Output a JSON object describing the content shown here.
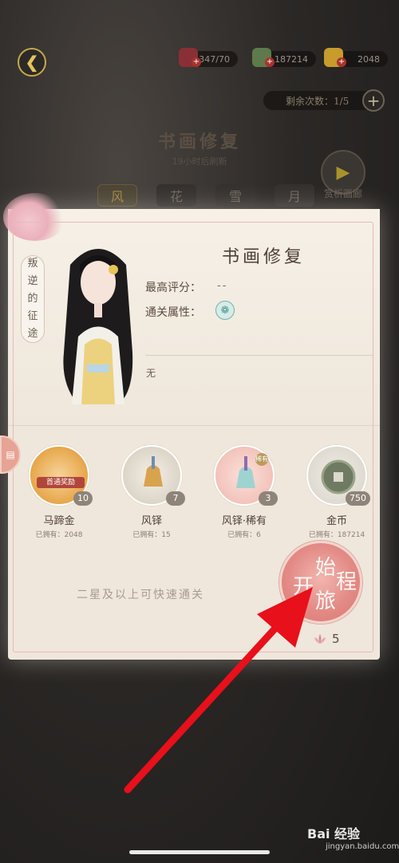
{
  "hud": {
    "stamina_value": "347/70",
    "silver_value": "187214",
    "gold_value": "2048",
    "remaining_label": "剩余次数：1/5"
  },
  "mode": {
    "title": "书画修复",
    "subtitle": "19小时后刷新",
    "gallery_label": "赏析画廊"
  },
  "seasons": [
    "风",
    "花",
    "雪",
    "月"
  ],
  "stage": {
    "chapter_tag": [
      "叛",
      "逆",
      "的",
      "征",
      "途"
    ],
    "title": "书画修复",
    "best_score_label": "最高评分：",
    "best_score_value": "--",
    "attribute_label": "通关属性：",
    "attribute_icon": "wind-attribute-icon",
    "description": "无"
  },
  "rewards": [
    {
      "name": "马蹄金",
      "owned": "已拥有：2048",
      "count": "10",
      "badge": "首通奖励",
      "icon": "horseshoe-gold-icon",
      "color": "#e7a64a"
    },
    {
      "name": "风铎",
      "owned": "已拥有：15",
      "count": "7",
      "icon": "wind-bell-icon",
      "color": "#d9a34e"
    },
    {
      "name": "风铎·稀有",
      "owned": "已拥有：6",
      "count": "3",
      "rare_tag": "稀有",
      "icon": "rare-wind-bell-icon",
      "color": "#9fd3cf"
    },
    {
      "name": "金币",
      "owned": "已拥有：187214",
      "count": "750",
      "icon": "coin-icon",
      "color": "#6f7a62"
    }
  ],
  "quick_hint": "二星及以上可快速通关",
  "start_button": {
    "chars": [
      "始",
      "开",
      "旅",
      "程"
    ],
    "cost": "5"
  },
  "watermark": {
    "brand": "Bai 经验",
    "url": "jingyan.baidu.com"
  }
}
